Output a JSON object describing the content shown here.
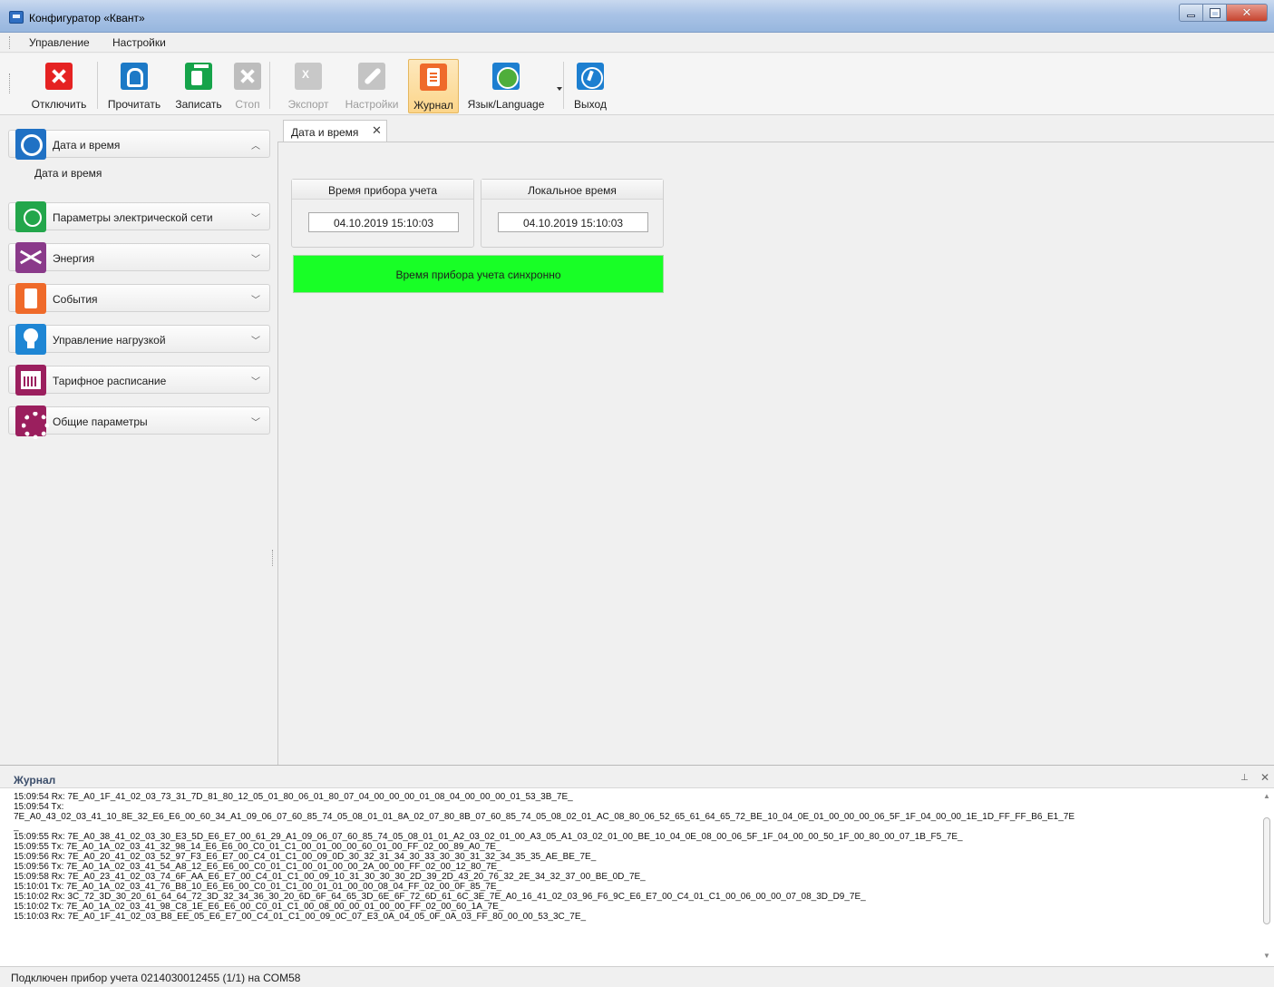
{
  "window": {
    "title": "Конфигуратор «Квант»"
  },
  "menu": {
    "items": [
      "Управление",
      "Настройки"
    ]
  },
  "toolbar": {
    "disconnect": "Отключить",
    "read": "Прочитать",
    "write": "Записать",
    "stop": "Стоп",
    "export": "Экспорт",
    "settings": "Настройки",
    "journal": "Журнал",
    "language": "Язык/Language",
    "exit": "Выход"
  },
  "nav": {
    "groups": [
      "Дата и время",
      "Параметры электрической сети",
      "Энергия",
      "События",
      "Управление нагрузкой",
      "Тарифное расписание",
      "Общие параметры"
    ],
    "sub_item": "Дата и время"
  },
  "tab": {
    "label": "Дата и время"
  },
  "meter_time": {
    "header": "Время прибора учета",
    "value": "04.10.2019 15:10:03"
  },
  "local_time": {
    "header": "Локальное время",
    "value": "04.10.2019 15:10:03"
  },
  "sync_status": {
    "text": "Время прибора учета синхронно",
    "color": "#18ff26"
  },
  "journal": {
    "title": "Журнал",
    "lines": [
      "15:09:54 Rx: 7E_A0_1F_41_02_03_73_31_7D_81_80_12_05_01_80_06_01_80_07_04_00_00_00_01_08_04_00_00_00_01_53_3B_7E_",
      "15:09:54 Tx:",
      "7E_A0_43_02_03_41_10_8E_32_E6_E6_00_60_34_A1_09_06_07_60_85_74_05_08_01_01_8A_02_07_80_8B_07_60_85_74_05_08_02_01_AC_08_80_06_52_65_61_64_65_72_BE_10_04_0E_01_00_00_00_06_5F_1F_04_00_00_1E_1D_FF_FF_B6_E1_7E",
      "_",
      "15:09:55 Rx: 7E_A0_38_41_02_03_30_E3_5D_E6_E7_00_61_29_A1_09_06_07_60_85_74_05_08_01_01_A2_03_02_01_00_A3_05_A1_03_02_01_00_BE_10_04_0E_08_00_06_5F_1F_04_00_00_50_1F_00_80_00_07_1B_F5_7E_",
      "15:09:55 Tx: 7E_A0_1A_02_03_41_32_98_14_E6_E6_00_C0_01_C1_00_01_00_00_60_01_00_FF_02_00_89_A0_7E_",
      "15:09:56 Rx: 7E_A0_20_41_02_03_52_97_F3_E6_E7_00_C4_01_C1_00_09_0D_30_32_31_34_30_33_30_30_31_32_34_35_35_AE_BE_7E_",
      "15:09:56 Tx: 7E_A0_1A_02_03_41_54_A8_12_E6_E6_00_C0_01_C1_00_01_00_00_2A_00_00_FF_02_00_12_80_7E_",
      "15:09:58 Rx: 7E_A0_23_41_02_03_74_6F_AA_E6_E7_00_C4_01_C1_00_09_10_31_30_30_30_2D_39_2D_43_20_76_32_2E_34_32_37_00_BE_0D_7E_",
      "15:10:01 Tx: 7E_A0_1A_02_03_41_76_B8_10_E6_E6_00_C0_01_C1_00_01_01_00_00_08_04_FF_02_00_0F_85_7E_",
      "15:10:02 Rx: 3C_72_3D_30_20_61_64_64_72_3D_32_34_36_30_20_6D_6F_64_65_3D_6E_6F_72_6D_61_6C_3E_7E_A0_16_41_02_03_96_F6_9C_E6_E7_00_C4_01_C1_00_06_00_00_07_08_3D_D9_7E_",
      "15:10:02 Tx: 7E_A0_1A_02_03_41_98_C8_1E_E6_E6_00_C0_01_C1_00_08_00_00_01_00_00_FF_02_00_60_1A_7E_",
      "15:10:03 Rx: 7E_A0_1F_41_02_03_B8_EE_05_E6_E7_00_C4_01_C1_00_09_0C_07_E3_0A_04_05_0F_0A_03_FF_80_00_00_53_3C_7E_"
    ]
  },
  "status": {
    "text": "Подключен прибор учета 0214030012455 (1/1) на COM58"
  }
}
